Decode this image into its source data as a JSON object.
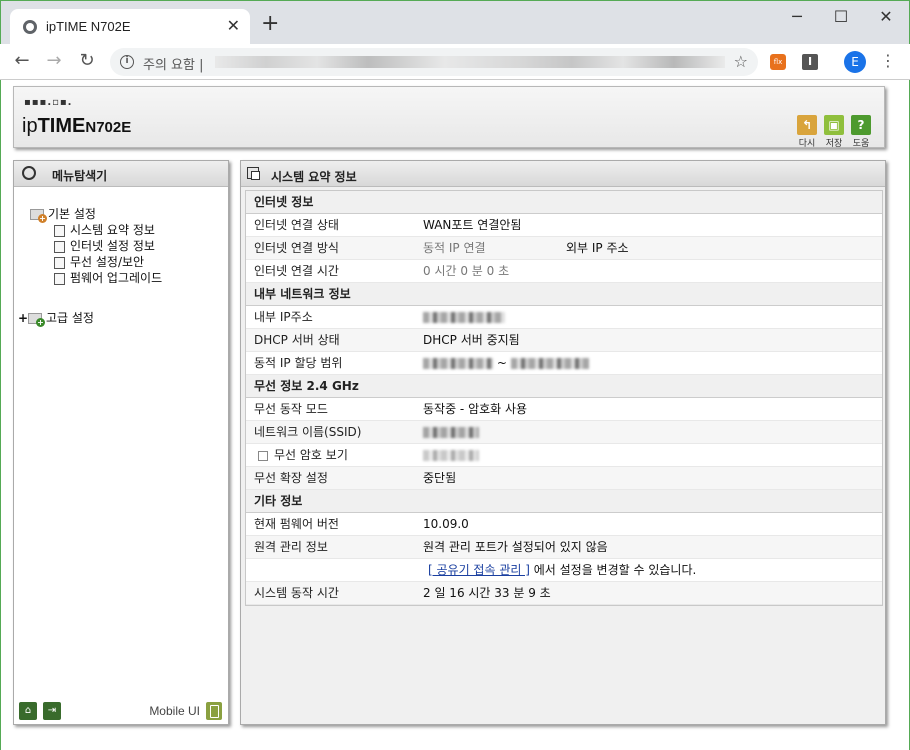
{
  "browser": {
    "tab_title": "ipTIME N702E",
    "tab_close": "✕",
    "new_tab": "+",
    "security_label": "주의 요함",
    "url_separator": "|",
    "window": {
      "minimize": "─",
      "maximize": "☐",
      "close": "✕"
    },
    "profile_initial": "E",
    "ext1_label": "flx",
    "ext2_label": "I"
  },
  "header": {
    "logo_dots": "▪▪▪.▫▪.",
    "logo_ip": "ip",
    "logo_time": "TIME",
    "model": "N702E",
    "buttons": [
      {
        "label": "다시",
        "icon": "undo-icon",
        "color": "#d9a43c"
      },
      {
        "label": "저장",
        "icon": "save-icon",
        "color": "#8fbf3c"
      },
      {
        "label": "도움",
        "icon": "help-icon",
        "color": "#4d9a2e"
      }
    ]
  },
  "left_panel": {
    "title": "메뉴탐색기",
    "basic": "기본 설정",
    "items": [
      "시스템 요약 정보",
      "인터넷 설정 정보",
      "무선 설정/보안",
      "펌웨어 업그레이드"
    ],
    "advanced": "고급 설정",
    "expander": "+",
    "mobile_ui": "Mobile UI"
  },
  "main": {
    "title": "시스템 요약 정보",
    "internet": {
      "title": "인터넷 정보",
      "status_label": "인터넷 연결 상태",
      "status_value": "WAN포트 연결안됨",
      "method_label": "인터넷 연결 방식",
      "method_value": "동적 IP 연결",
      "external_ip_label": "외부 IP 주소",
      "time_label": "인터넷 연결 시간",
      "time_value": "0 시간 0 분 0 초"
    },
    "lan": {
      "title": "내부 네트워크 정보",
      "ip_label": "내부 IP주소",
      "dhcp_label": "DHCP 서버 상태",
      "dhcp_value": "DHCP 서버 중지됨",
      "range_label": "동적 IP 할당 범위",
      "range_sep": "~"
    },
    "wireless": {
      "title": "무선 정보 2.4 GHz",
      "mode_label": "무선 동작 모드",
      "mode_value": "동작중 - 암호화 사용",
      "ssid_label": "네트워크 이름(SSID)",
      "pw_label": "무선 암호 보기",
      "ext_label": "무선 확장 설정",
      "ext_value": "중단됨"
    },
    "etc": {
      "title": "기타 정보",
      "fw_label": "현재 펌웨어 버전",
      "fw_value": "10.09.0",
      "remote_label": "원격 관리 정보",
      "remote_value": "원격 관리 포트가 설정되어 있지 않음",
      "remote_link": "[ 공유기 접속 관리 ]",
      "remote_link_suffix": " 에서 설정을 변경할 수 있습니다.",
      "uptime_label": "시스템 동작 시간",
      "uptime_value": "2 일 16 시간 33 분 9 초"
    }
  }
}
